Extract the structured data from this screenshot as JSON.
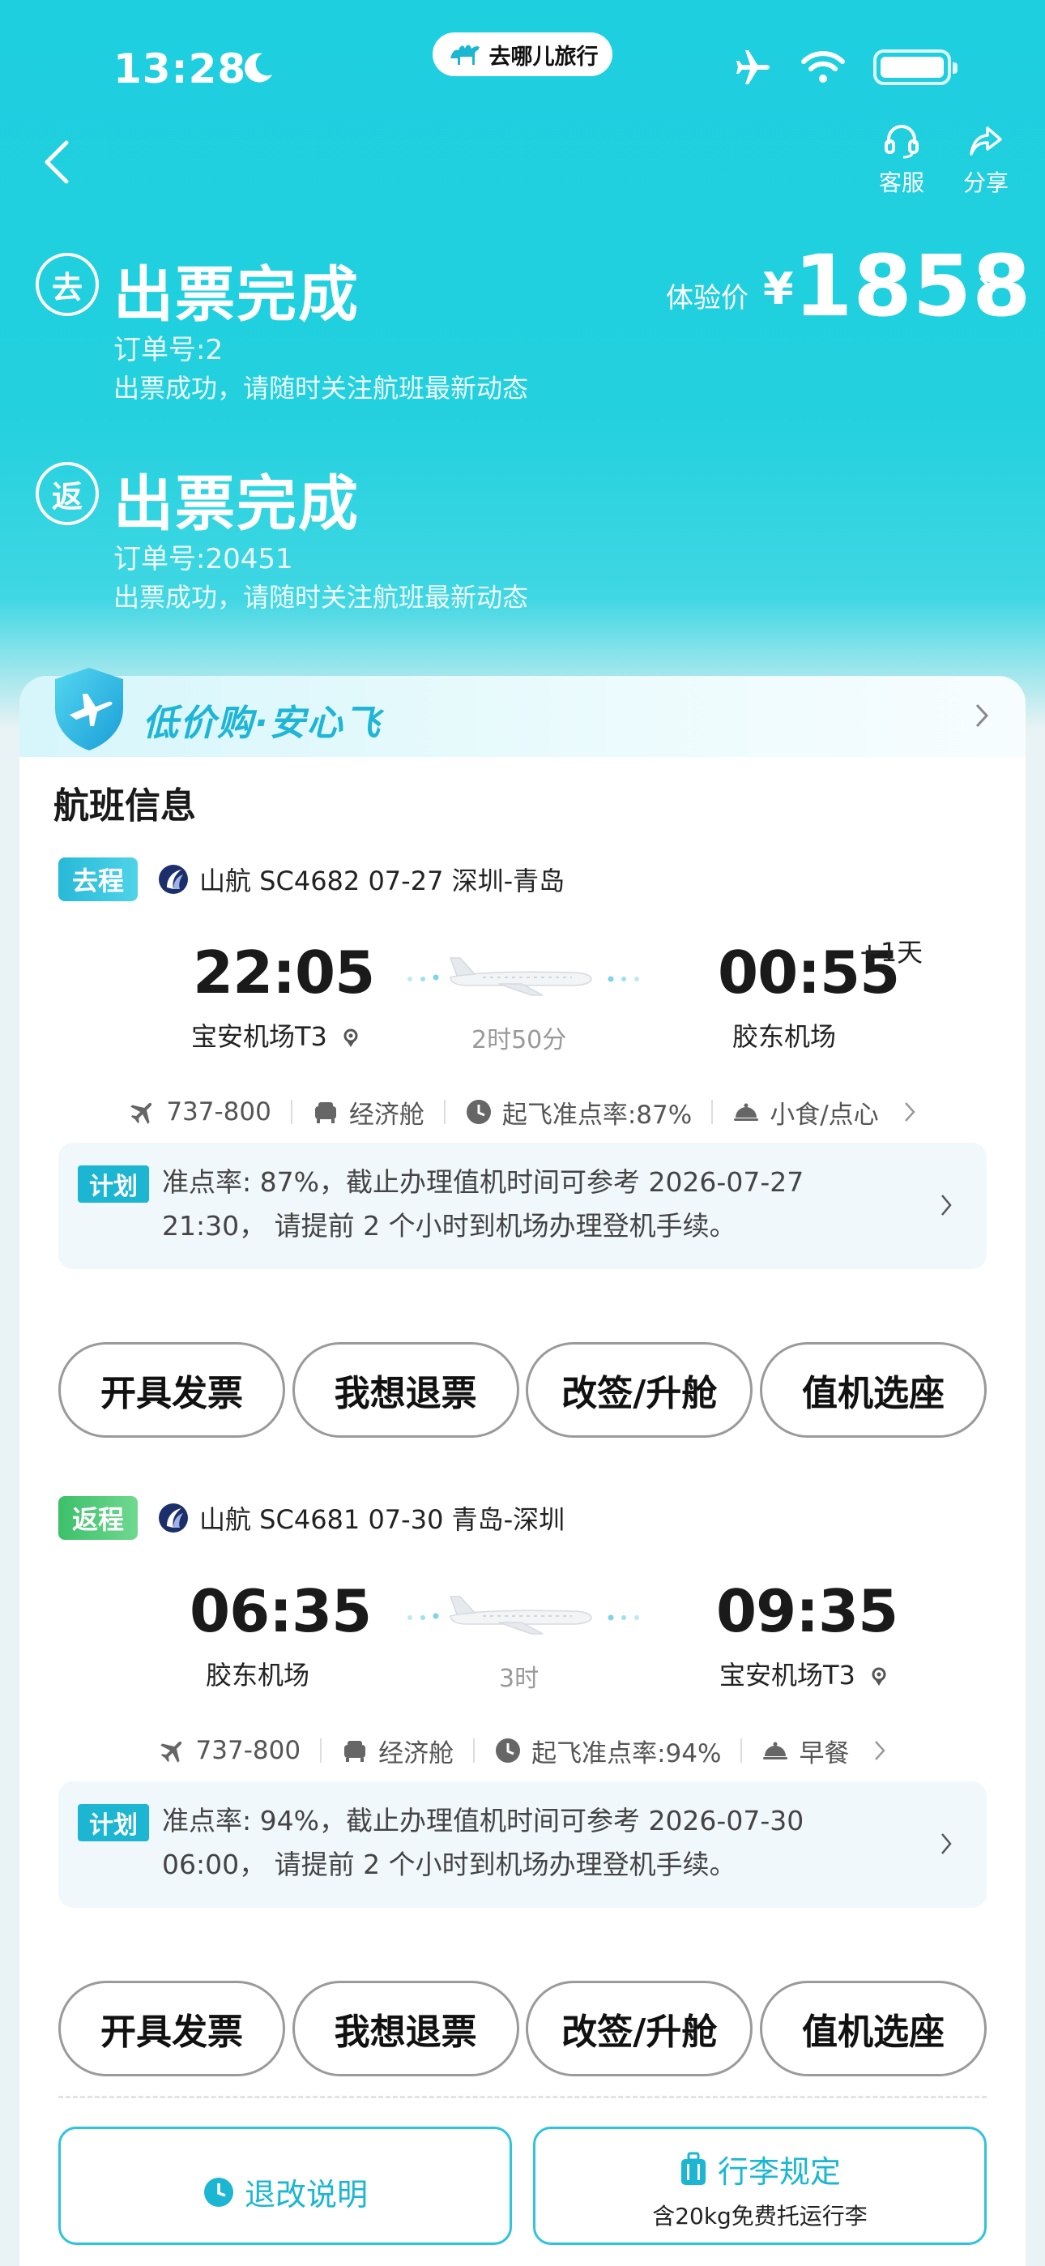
{
  "status_bar": {
    "time": "13:28",
    "app_name": "去哪儿旅行"
  },
  "nav": {
    "service_label": "客服",
    "share_label": "分享"
  },
  "orders": [
    {
      "badge": "去",
      "title": "出票完成",
      "order_no": "订单号:2",
      "note": "出票成功，请随时关注航班最新动态"
    },
    {
      "badge": "返",
      "title": "出票完成",
      "order_no": "订单号:20451",
      "note": "出票成功，请随时关注航班最新动态"
    }
  ],
  "price": {
    "label": "体验价",
    "currency": "¥",
    "value": "1858"
  },
  "promo": {
    "text": "低价购·安心飞"
  },
  "section_title": "航班信息",
  "segments": [
    {
      "direction": "去程",
      "info": "山航 SC4682   07-27 深圳-青岛",
      "dep_time": "22:05",
      "dep_airport": "宝安机场T3",
      "arr_time": "00:55",
      "arr_airport": "胶东机场",
      "plus_day": "+1天",
      "duration": "2时50分",
      "aircraft": "737-800",
      "cabin": "经济舱",
      "on_time": "起飞准点率:87%",
      "meal": "小食/点心",
      "plan_tag": "计划",
      "plan_line1": "准点率: 87%，截止办理值机时间可参考 2026-07-27",
      "plan_line2": "21:30，  请提前 2 个小时到机场办理登机手续。"
    },
    {
      "direction": "返程",
      "info": "山航 SC4681   07-30 青岛-深圳",
      "dep_time": "06:35",
      "dep_airport": "胶东机场",
      "arr_time": "09:35",
      "arr_airport": "宝安机场T3",
      "plus_day": "",
      "duration": "3时",
      "aircraft": "737-800",
      "cabin": "经济舱",
      "on_time": "起飞准点率:94%",
      "meal": "早餐",
      "plan_tag": "计划",
      "plan_line1": "准点率: 94%，截止办理值机时间可参考 2026-07-30",
      "plan_line2": "06:00，  请提前 2 个小时到机场办理登机手续。"
    }
  ],
  "actions": [
    "开具发票",
    "我想退票",
    "改签/升舱",
    "值机选座"
  ],
  "bottom": {
    "refund_rules": "退改说明",
    "baggage_title": "行李规定",
    "baggage_sub": "含20kg免费托运行李"
  },
  "colors": {
    "header": "#1ecfdf",
    "accent": "#1cb6d2",
    "outbound_tag": "#2bbfd9",
    "return_tag": "#43c46a"
  }
}
